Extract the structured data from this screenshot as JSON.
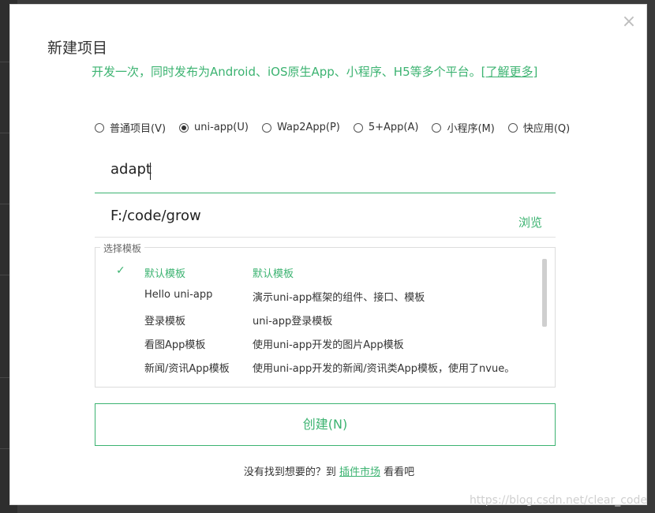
{
  "dialog": {
    "title": "新建项目",
    "subtitle": "开发一次，同时发布为Android、iOS原生App、小程序、H5等多个平台。",
    "learn_more": "[了解更多]",
    "close_icon": "close-icon"
  },
  "project_types": [
    {
      "label": "普通项目(V)",
      "checked": false
    },
    {
      "label": "uni-app(U)",
      "checked": true
    },
    {
      "label": "Wap2App(P)",
      "checked": false
    },
    {
      "label": "5+App(A)",
      "checked": false
    },
    {
      "label": "小程序(M)",
      "checked": false
    },
    {
      "label": "快应用(Q)",
      "checked": false
    }
  ],
  "project_name": {
    "value": "adapt"
  },
  "project_path": {
    "value": "F:/code/grow",
    "browse_label": "浏览"
  },
  "templates": {
    "legend": "选择模板",
    "items": [
      {
        "name": "默认模板",
        "desc": "默认模板",
        "selected": true
      },
      {
        "name": "Hello uni-app",
        "desc": "演示uni-app框架的组件、接口、模板",
        "selected": false
      },
      {
        "name": "登录模板",
        "desc": "uni-app登录模板",
        "selected": false
      },
      {
        "name": "看图App模板",
        "desc": "使用uni-app开发的图片App模板",
        "selected": false
      },
      {
        "name": "新闻/资讯App模板",
        "desc": "使用uni-app开发的新闻/资讯类App模板，使用了nvue。",
        "selected": false
      }
    ]
  },
  "create_button": {
    "label": "创建(N)"
  },
  "footer": {
    "prefix": "没有找到想要的？到",
    "link": "插件市场",
    "suffix": "看看吧"
  },
  "watermark": "https://blog.csdn.net/clear_code",
  "colors": {
    "accent": "#3cb371"
  }
}
